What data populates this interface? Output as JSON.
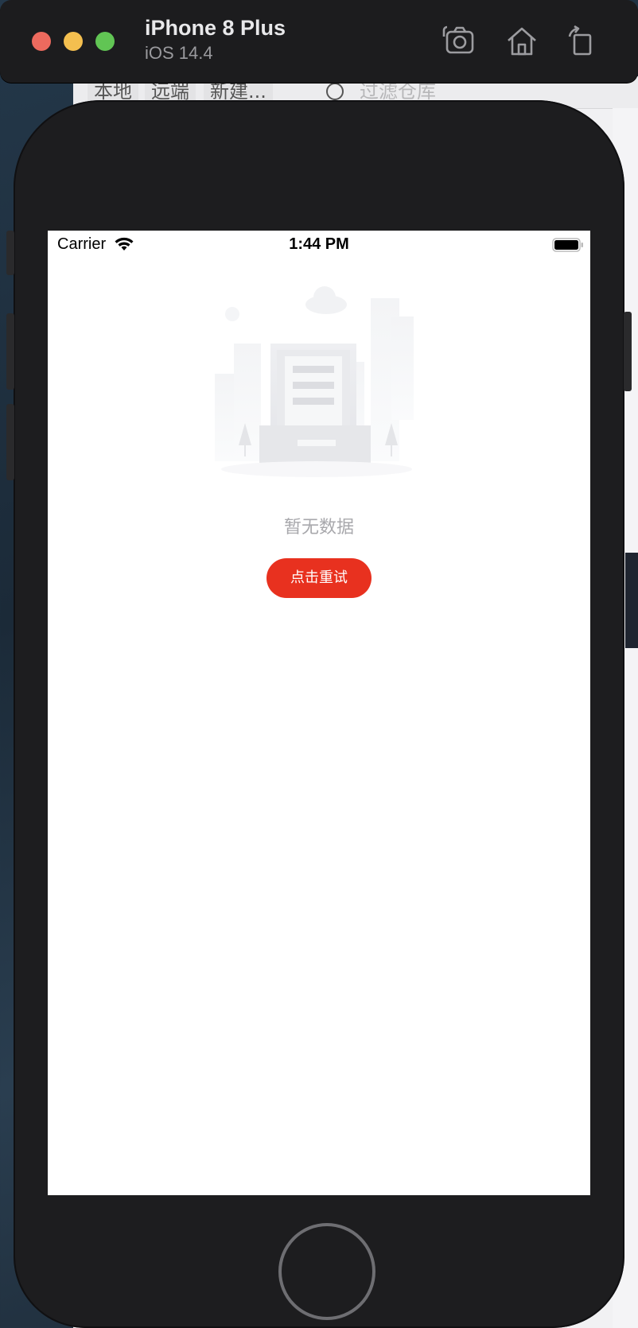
{
  "window": {
    "title": "iPhone 8 Plus",
    "subtitle": "iOS 14.4",
    "toolbar_icons": [
      "screenshot-icon",
      "home-icon",
      "rotate-icon"
    ]
  },
  "background_app": {
    "segments": [
      "本地",
      "远端",
      "新建..."
    ],
    "filter_placeholder": "过滤仓库"
  },
  "status_bar": {
    "carrier": "Carrier",
    "time": "1:44 PM"
  },
  "empty_state": {
    "message": "暂无数据",
    "retry_label": "点击重试"
  },
  "colors": {
    "accent": "#e8311f",
    "empty_text": "#a8a8ac",
    "device_frame": "#1d1d1f"
  }
}
